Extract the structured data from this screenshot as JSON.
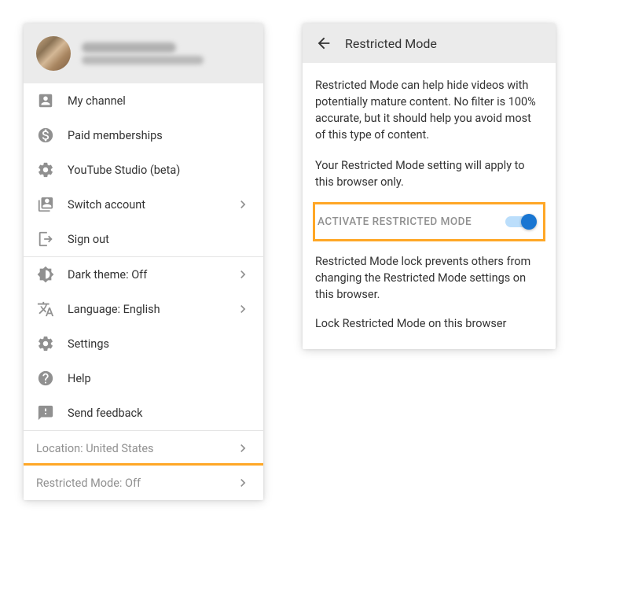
{
  "leftPanel": {
    "section1": [
      {
        "icon": "account-box",
        "label": "My channel"
      },
      {
        "icon": "paid",
        "label": "Paid memberships"
      },
      {
        "icon": "studio-gear",
        "label": "YouTube Studio (beta)"
      },
      {
        "icon": "switch-account",
        "label": "Switch account",
        "chevron": true
      },
      {
        "icon": "sign-out",
        "label": "Sign out"
      }
    ],
    "section2": [
      {
        "icon": "dark-theme",
        "label": "Dark theme: Off",
        "chevron": true
      },
      {
        "icon": "language",
        "label": "Language: English",
        "chevron": true
      },
      {
        "icon": "settings-gear",
        "label": "Settings"
      },
      {
        "icon": "help",
        "label": "Help"
      },
      {
        "icon": "feedback",
        "label": "Send feedback"
      }
    ],
    "footer": [
      {
        "label": "Location: United States",
        "chevron": true
      },
      {
        "label": "Restricted Mode: Off",
        "chevron": true,
        "highlight": true
      }
    ]
  },
  "rightPanel": {
    "title": "Restricted Mode",
    "body1": "Restricted Mode can help hide videos with potentially mature content. No filter is 100% accurate, but it should help you avoid most of this type of content.",
    "body2": "Your Restricted Mode setting will apply to this browser only.",
    "toggleLabel": "ACTIVATE RESTRICTED MODE",
    "lockText": "Restricted Mode lock prevents others from changing the Restricted Mode settings on this browser.",
    "lockLink": "Lock Restricted Mode on this browser"
  }
}
